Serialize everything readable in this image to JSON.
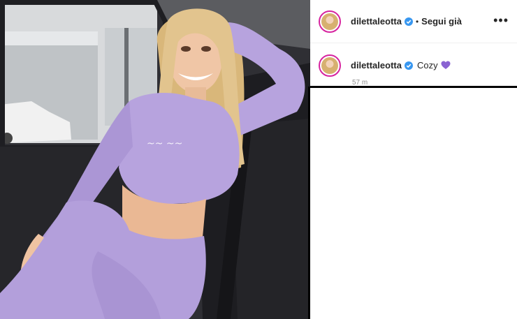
{
  "post": {
    "author": {
      "username": "dilettaleotta",
      "verified": true,
      "follow_status": "Segui già"
    },
    "caption": {
      "username": "dilettaleotta",
      "text": "Cozy",
      "emoji": "purple-heart-icon",
      "timestamp": "57 m"
    }
  },
  "icons": {
    "verified": "verified-badge-icon",
    "more": "more-options-icon",
    "heart": "purple-heart-icon"
  },
  "colors": {
    "verified_blue": "#3897f0",
    "heart_purple": "#8a63d2",
    "outfit_lilac": "#b7a3de",
    "story_ring": "#d6249f"
  }
}
